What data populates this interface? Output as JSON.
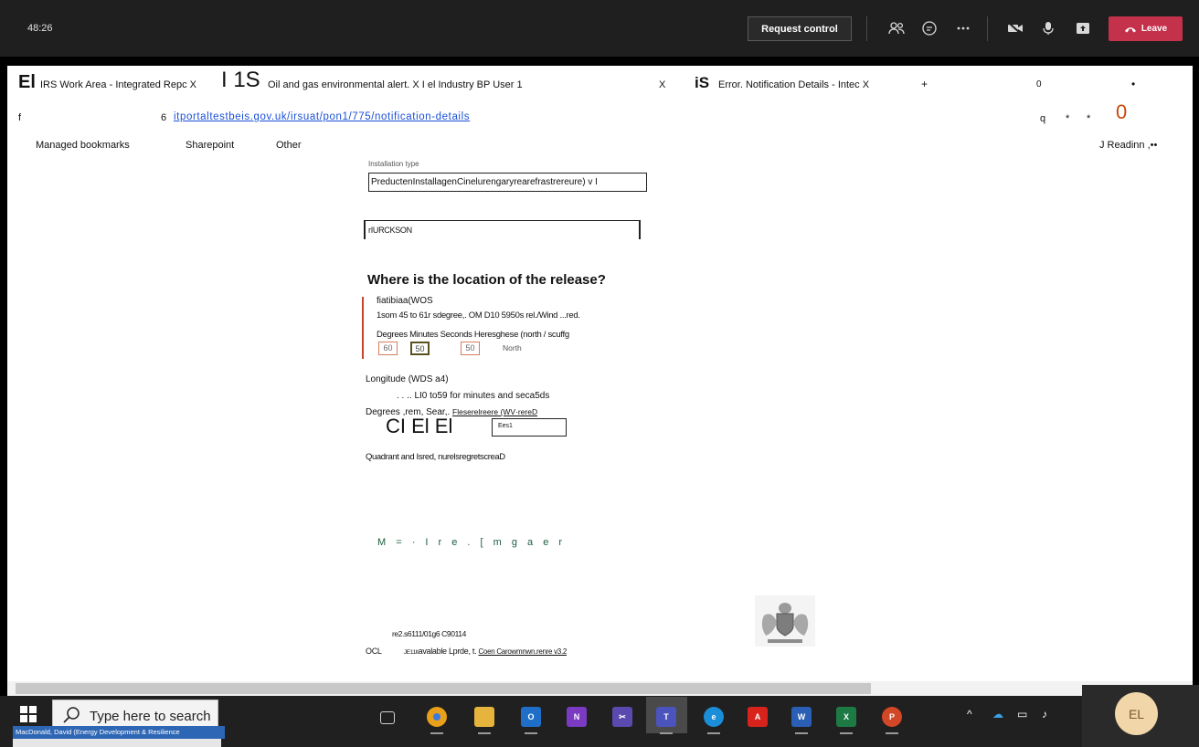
{
  "meeting": {
    "timer": "48:26",
    "request_control_label": "Request control",
    "leave_label": "Leave",
    "colors": {
      "bar": "#1f1f1f",
      "leave": "#c4314b"
    }
  },
  "browser": {
    "tab1": {
      "mark": "El",
      "title": "IRS Work Area - Integrated Repc X"
    },
    "tab2": {
      "mark": "I 1S",
      "title": "Oil and gas environmental alert. X I el Industry BP User 1",
      "close": "X"
    },
    "tab3": {
      "mark": "iS",
      "title": "Error. Notification Details - Intec X"
    },
    "new_tab": "+",
    "window_min": "0",
    "window_dot": "•",
    "back": "f",
    "addr_prefix": "6",
    "url": "itportaltestbeis.gov.uk/irsuat/pon1/775/notification-details",
    "q": "q",
    "star1": "*",
    "star2": "*",
    "zero": "0",
    "bookmarks": [
      "Managed bookmarks",
      "Sharepoint",
      "Other"
    ],
    "reading": "J Readinn ,••"
  },
  "page": {
    "installation_type_label": "Installation type",
    "installation_value": "PreductenInstallagenCinelurengaryrearefrastrereure) v I",
    "name_value": "rIURCKSON",
    "heading": "Where is the location of the release?",
    "latitude": {
      "label": "fiatibiaa(WOS",
      "hint": "1som 45 to 61r sdegree,. OM D10 5950s rel./Wind ...red.",
      "units": "Degrees Minutes Seconds Heresghese (north / scuffg",
      "degrees": "60",
      "minutes": "50",
      "seconds": "50",
      "hemisphere": "North"
    },
    "longitude": {
      "label": "Longitude (WDS a4)",
      "hint": ".      .        .. LI0 to59 for minutes and seca5ds",
      "units": "Degrees ,rem, Sear,.",
      "units_link": "Fleserelreere (WV·rereD",
      "boxes": "CI El El",
      "direction": "Ees1"
    },
    "quadrant": "Quadrant and Isred, nurelsregretscreaD",
    "mgaer": "M = · I r e . [ m g a e r",
    "footer_id": "re2.s6111/01g6 C90114",
    "footer_ocl": "OCL",
    "footer_small": "JE11lt",
    "footer_text": "avalable Lprde, t.",
    "footer_link": "Coen Carowmnwn.renre v3.2"
  },
  "taskbar": {
    "search_placeholder": "Type here to search",
    "tooltip": "MacDonald, David (Energy Development & Resilience",
    "avatar_initials": "EL",
    "apps": [
      "task-view",
      "chrome",
      "file-explorer",
      "outlook",
      "onenote",
      "snipping",
      "teams",
      "edge",
      "acrobat",
      "word",
      "excel",
      "powerpoint"
    ]
  }
}
